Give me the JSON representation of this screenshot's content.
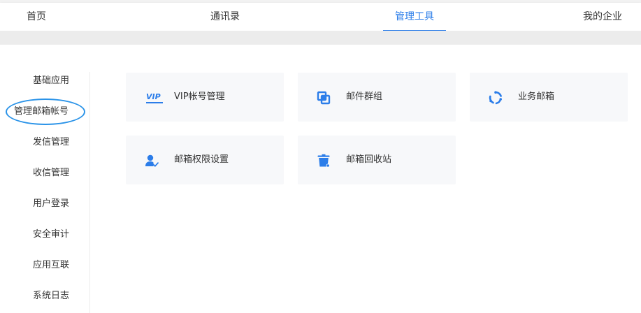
{
  "topnav": {
    "items": [
      {
        "label": "首页"
      },
      {
        "label": "通讯录"
      },
      {
        "label": "管理工具",
        "active": true
      },
      {
        "label": "我的企业"
      }
    ]
  },
  "sidebar": {
    "items": [
      {
        "label": "基础应用"
      },
      {
        "label": "管理邮箱帐号",
        "active": true
      },
      {
        "label": "发信管理"
      },
      {
        "label": "收信管理"
      },
      {
        "label": "用户登录"
      },
      {
        "label": "安全审计"
      },
      {
        "label": "应用互联"
      },
      {
        "label": "系统日志"
      }
    ]
  },
  "cards": [
    {
      "label": "VIP帐号管理",
      "icon": "vip-icon",
      "icon_text": "VIP"
    },
    {
      "label": "邮件群组",
      "icon": "group-icon"
    },
    {
      "label": "业务邮箱",
      "icon": "cycle-icon"
    },
    {
      "label": "邮箱权限设置",
      "icon": "user-permission-icon"
    },
    {
      "label": "邮箱回收站",
      "icon": "trash-icon"
    }
  ],
  "colors": {
    "accent": "#2b7de9",
    "highlight": "#2a93e8",
    "card_bg": "#f7f8fa"
  }
}
